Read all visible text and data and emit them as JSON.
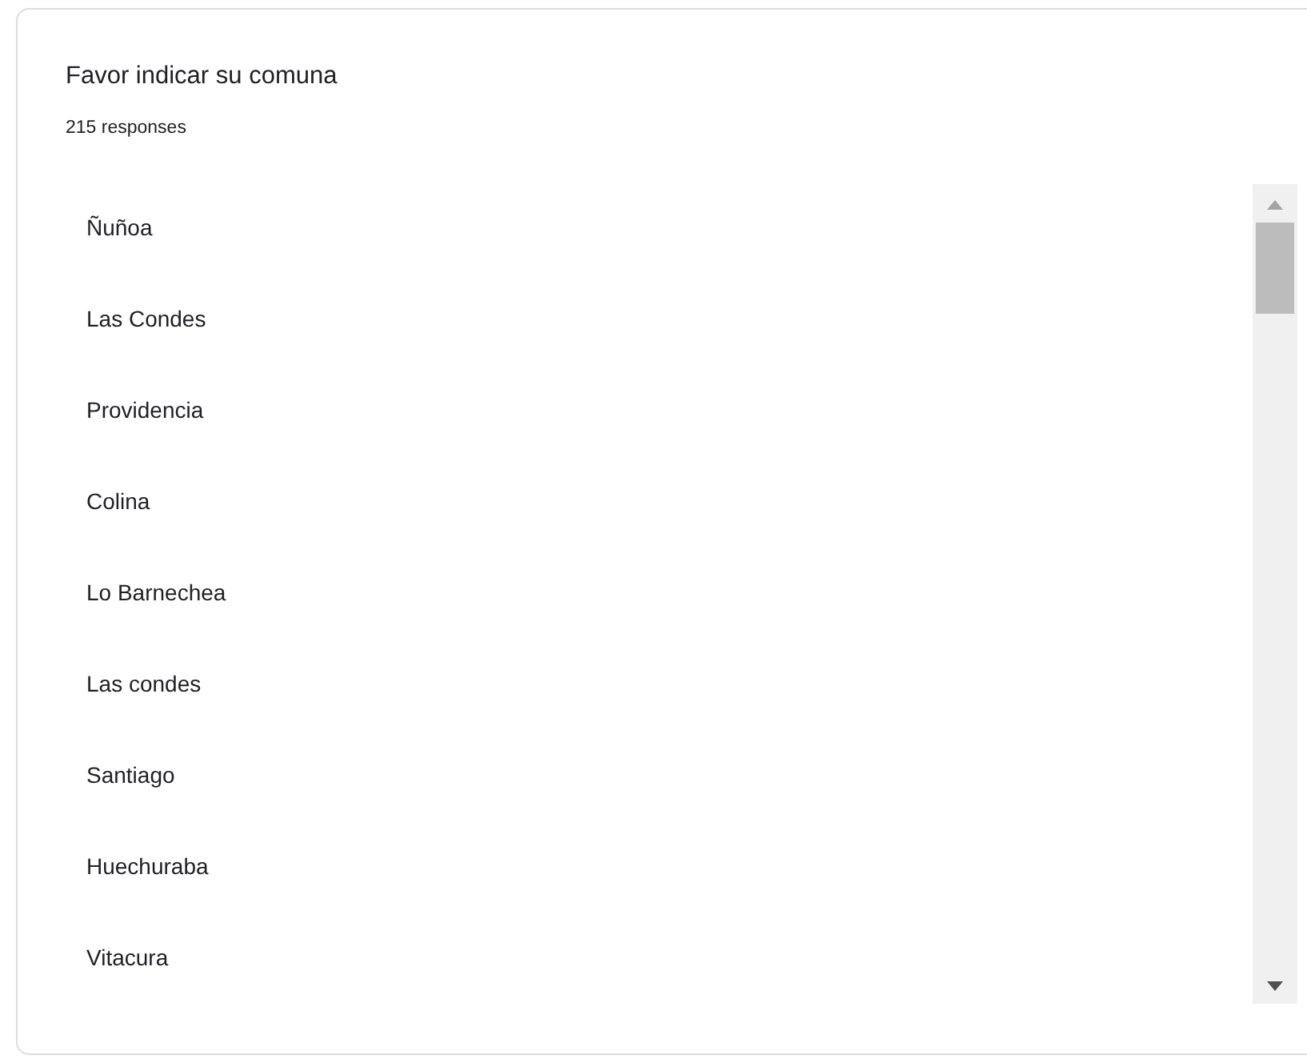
{
  "question": {
    "title": "Favor indicar su comuna",
    "count": "215 responses"
  },
  "responses": [
    "Ñuñoa",
    "Las Condes",
    "Providencia",
    "Colina",
    "Lo Barnechea",
    "Las condes",
    "Santiago",
    "Huechuraba",
    "Vitacura"
  ]
}
